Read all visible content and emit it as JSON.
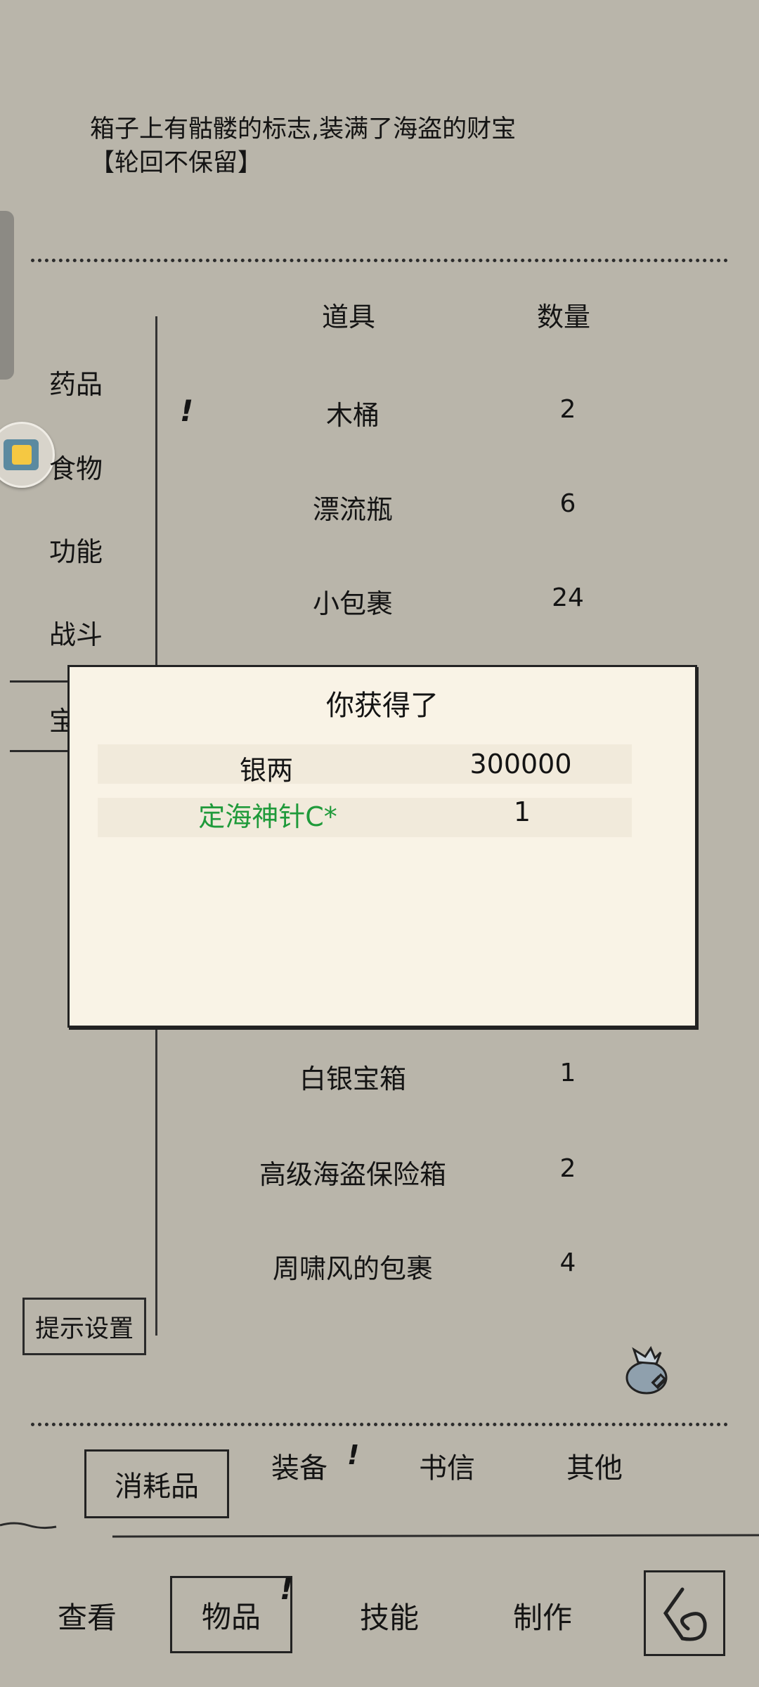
{
  "description": {
    "line1": "箱子上有骷髅的标志,装满了海盗的财宝",
    "line2": "【轮回不保留】"
  },
  "categories": [
    "药品",
    "食物",
    "功能",
    "战斗",
    "宝"
  ],
  "table": {
    "headers": {
      "item": "道具",
      "qty": "数量"
    },
    "rows_top": [
      {
        "name": "木桶",
        "qty": "2",
        "alert": "!"
      },
      {
        "name": "漂流瓶",
        "qty": "6"
      },
      {
        "name": "小包裹",
        "qty": "24"
      }
    ],
    "rows_bottom": [
      {
        "name": "白银宝箱",
        "qty": "1"
      },
      {
        "name": "高级海盗保险箱",
        "qty": "2"
      },
      {
        "name": "周啸风的包裹",
        "qty": "4"
      }
    ]
  },
  "tip_button": "提示设置",
  "modal": {
    "title": "你获得了",
    "rewards": [
      {
        "name": "银两",
        "qty": "300000"
      },
      {
        "name": "定海神针C*",
        "qty": "1",
        "color": "#1f9a3a"
      }
    ]
  },
  "sub_tabs": [
    "消耗品",
    "装备",
    "书信",
    "其他"
  ],
  "sub_tab_alert": "!",
  "nav": [
    "查看",
    "物品",
    "技能",
    "制作"
  ],
  "nav_alert": "!",
  "icons": {
    "bag": "money-bag-icon",
    "back": "back-arrow-icon",
    "float": "floating-app-icon"
  }
}
